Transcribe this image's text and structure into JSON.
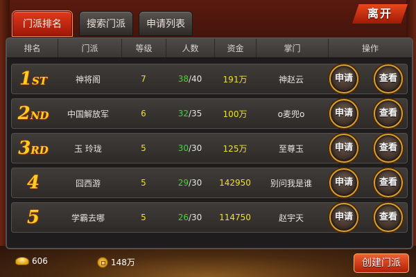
{
  "tabs": [
    {
      "label": "门派排名",
      "active": true
    },
    {
      "label": "搜索门派",
      "active": false
    },
    {
      "label": "申请列表",
      "active": false
    }
  ],
  "leave_label": "离开",
  "table": {
    "headers": [
      "排名",
      "门派",
      "等级",
      "人数",
      "资金",
      "掌门",
      "操作"
    ],
    "rows": [
      {
        "rank": "1",
        "rank_suffix": "ST",
        "name": "神将阁",
        "level": "7",
        "members": "38",
        "capacity": "/40",
        "funds": "191万",
        "leader": "神赵云",
        "apply": "申请",
        "view": "查看"
      },
      {
        "rank": "2",
        "rank_suffix": "ND",
        "name": "中国解放军",
        "level": "6",
        "members": "32",
        "capacity": "/35",
        "funds": "100万",
        "leader": "o麦兜o",
        "apply": "申请",
        "view": "查看"
      },
      {
        "rank": "3",
        "rank_suffix": "RD",
        "name": "玉 玲珑",
        "level": "5",
        "members": "30",
        "capacity": "/30",
        "funds": "125万",
        "leader": "至尊玉",
        "apply": "申请",
        "view": "查看"
      },
      {
        "rank": "4",
        "rank_suffix": "",
        "name": "囧西游",
        "level": "5",
        "members": "29",
        "capacity": "/30",
        "funds": "142950",
        "leader": "别问我是谁",
        "apply": "申请",
        "view": "查看"
      },
      {
        "rank": "5",
        "rank_suffix": "",
        "name": "学霸去哪",
        "level": "5",
        "members": "26",
        "capacity": "/30",
        "funds": "114750",
        "leader": "赵宇天",
        "apply": "申请",
        "view": "查看"
      }
    ]
  },
  "footer": {
    "ingots": "606",
    "coins": "148万",
    "create_label": "创建门派"
  }
}
